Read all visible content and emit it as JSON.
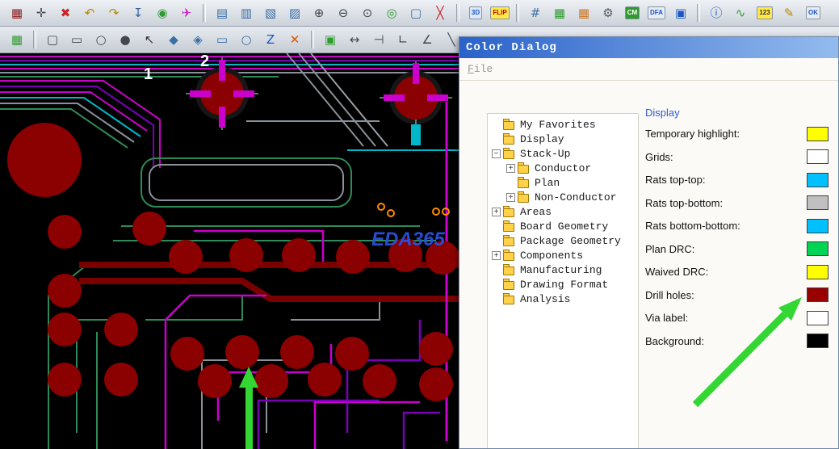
{
  "canvas": {
    "watermark": "EDA365",
    "label_1": "1",
    "label_2": "2"
  },
  "annotations": {
    "arrow_color": "#33d633"
  },
  "toolbar_main": {
    "icons": [
      {
        "name": "color-grid-icon",
        "glyph": "▦",
        "color": "#8b1a1a"
      },
      {
        "name": "pan-icon",
        "glyph": "✛",
        "color": "#44484e"
      },
      {
        "name": "delete-icon",
        "glyph": "✖",
        "color": "#cc2222"
      },
      {
        "name": "undo-icon",
        "glyph": "↶",
        "color": "#b8860b"
      },
      {
        "name": "redo-icon",
        "glyph": "↷",
        "color": "#b8860b"
      },
      {
        "name": "export-icon",
        "glyph": "↧",
        "color": "#336699"
      },
      {
        "name": "world-view-icon",
        "glyph": "◉",
        "color": "#2e9b2e"
      },
      {
        "name": "fly-line-icon",
        "glyph": "✈",
        "color": "#cc22cc"
      },
      {
        "type": "sep"
      },
      {
        "name": "window-view-1-icon",
        "glyph": "▤",
        "color": "#3a6ea5"
      },
      {
        "name": "window-view-2-icon",
        "glyph": "▥",
        "color": "#3a6ea5"
      },
      {
        "name": "window-view-3-icon",
        "glyph": "▧",
        "color": "#3a6ea5"
      },
      {
        "name": "window-view-4-icon",
        "glyph": "▨",
        "color": "#3a6ea5"
      },
      {
        "name": "zoom-in-icon",
        "glyph": "⊕",
        "color": "#44484e"
      },
      {
        "name": "zoom-out-icon",
        "glyph": "⊖",
        "color": "#44484e"
      },
      {
        "name": "zoom-point-icon",
        "glyph": "⊙",
        "color": "#44484e"
      },
      {
        "name": "zoom-world-icon",
        "glyph": "◎",
        "color": "#2e9b2e"
      },
      {
        "name": "redraw-icon",
        "glyph": "▢",
        "color": "#3a6ea5"
      },
      {
        "name": "swap-layers-icon",
        "glyph": "╳",
        "color": "#cc2222"
      },
      {
        "type": "sep"
      },
      {
        "name": "3d-view-icon",
        "text": "3D",
        "color": "#1a56c4",
        "bg": "#dce8f8"
      },
      {
        "name": "flip-board-icon",
        "text": "FLIP",
        "color": "#c00000",
        "bg": "#ffe84a"
      },
      {
        "type": "sep"
      },
      {
        "name": "grid-toggle-icon",
        "glyph": "#",
        "color": "#3a6ea5"
      },
      {
        "name": "layer-grid-icon",
        "glyph": "▦",
        "color": "#2e9b2e"
      },
      {
        "name": "layer-grid-alt-icon",
        "glyph": "▦",
        "color": "#cc7722"
      },
      {
        "name": "gear-icon",
        "glyph": "⚙",
        "color": "#555a60"
      },
      {
        "name": "constraint-manager-icon",
        "text": "CM",
        "color": "#ffffff",
        "bg": "#2e9b2e"
      },
      {
        "name": "dfa-check-icon",
        "text": "DFA",
        "color": "#1a56c4",
        "bg": "#e8edf5"
      },
      {
        "name": "chip-icon",
        "glyph": "▣",
        "color": "#1a56c4"
      },
      {
        "type": "sep"
      },
      {
        "name": "info-icon",
        "glyph": "ⓘ",
        "color": "#1a56c4"
      },
      {
        "name": "waveform-icon",
        "glyph": "∿",
        "color": "#2e9b2e"
      },
      {
        "name": "numbers-icon",
        "text": "123",
        "color": "#333333",
        "bg": "#ffe84a"
      },
      {
        "name": "edit-pencil-icon",
        "glyph": "✎",
        "color": "#b8860b"
      },
      {
        "name": "ok-check-icon",
        "text": "OK",
        "color": "#1a56c4",
        "bg": "#e8edf5"
      }
    ]
  },
  "toolbar_draw": {
    "icons": [
      {
        "name": "board-icon",
        "glyph": "▦",
        "color": "#2e9b2e"
      },
      {
        "type": "sep"
      },
      {
        "name": "slot-tool-icon",
        "glyph": "▢",
        "color": "#44484e"
      },
      {
        "name": "rect-tool-icon",
        "glyph": "▭",
        "color": "#44484e"
      },
      {
        "name": "circle-tool-icon",
        "glyph": "○",
        "color": "#44484e"
      },
      {
        "name": "pad-tool-icon",
        "glyph": "●",
        "color": "#44484e"
      },
      {
        "name": "pick-tool-icon",
        "glyph": "↖",
        "color": "#333333"
      },
      {
        "name": "shape-polygon-tool-icon",
        "glyph": "◆",
        "color": "#3a6ea5"
      },
      {
        "name": "shape-cut-tool-icon",
        "glyph": "◈",
        "color": "#3a6ea5"
      },
      {
        "name": "shape-rect-tool-icon",
        "glyph": "▭",
        "color": "#3a6ea5"
      },
      {
        "name": "shape-circle-tool-icon",
        "glyph": "○",
        "color": "#3a6ea5"
      },
      {
        "name": "z-route-icon",
        "glyph": "Z",
        "color": "#1a56c4"
      },
      {
        "name": "delete-segment-icon",
        "glyph": "✕",
        "color": "#e05500"
      },
      {
        "type": "sep"
      },
      {
        "name": "module-icon",
        "glyph": "▣",
        "color": "#2e9b2e"
      },
      {
        "name": "measure-icon",
        "glyph": "↔",
        "color": "#44484e"
      },
      {
        "name": "dimension-icon",
        "glyph": "⊣",
        "color": "#44484e"
      },
      {
        "name": "dimension-corner-icon",
        "glyph": "∟",
        "color": "#44484e"
      },
      {
        "name": "angle-icon",
        "glyph": "∠",
        "color": "#44484e"
      },
      {
        "name": "line-45-icon",
        "glyph": "╲",
        "color": "#44484e"
      }
    ]
  },
  "dialog": {
    "title": "Color Dialog",
    "menu": {
      "file": "File"
    },
    "tree": [
      {
        "label": "My Favorites",
        "depth": 0,
        "expand": "none"
      },
      {
        "label": "Display",
        "depth": 0,
        "expand": "none"
      },
      {
        "label": "Stack-Up",
        "depth": 0,
        "expand": "minus"
      },
      {
        "label": "Conductor",
        "depth": 1,
        "expand": "plus"
      },
      {
        "label": "Plan",
        "depth": 1,
        "expand": "none"
      },
      {
        "label": "Non-Conductor",
        "depth": 1,
        "expand": "plus"
      },
      {
        "label": "Areas",
        "depth": 0,
        "expand": "plus"
      },
      {
        "label": "Board Geometry",
        "depth": 0,
        "expand": "none"
      },
      {
        "label": "Package Geometry",
        "depth": 0,
        "expand": "none"
      },
      {
        "label": "Components",
        "depth": 0,
        "expand": "plus"
      },
      {
        "label": "Manufacturing",
        "depth": 0,
        "expand": "none"
      },
      {
        "label": "Drawing Format",
        "depth": 0,
        "expand": "none"
      },
      {
        "label": "Analysis",
        "depth": 0,
        "expand": "none"
      }
    ],
    "display": {
      "caption": "Display",
      "items": [
        {
          "label": "Temporary highlight:",
          "color": "#ffff00"
        },
        {
          "label": "Grids:",
          "color": "#ffffff"
        },
        {
          "label": "Rats top-top:",
          "color": "#00c0ff"
        },
        {
          "label": "Rats top-bottom:",
          "color": "#c0c0c0"
        },
        {
          "label": "Rats bottom-bottom:",
          "color": "#00c0ff"
        },
        {
          "label": "Plan DRC:",
          "color": "#00d455"
        },
        {
          "label": "Waived DRC:",
          "color": "#ffff00"
        },
        {
          "label": "Drill holes:",
          "color": "#990000"
        },
        {
          "label": "Via label:",
          "color": "#ffffff"
        },
        {
          "label": "Background:",
          "color": "#000000"
        }
      ]
    }
  }
}
